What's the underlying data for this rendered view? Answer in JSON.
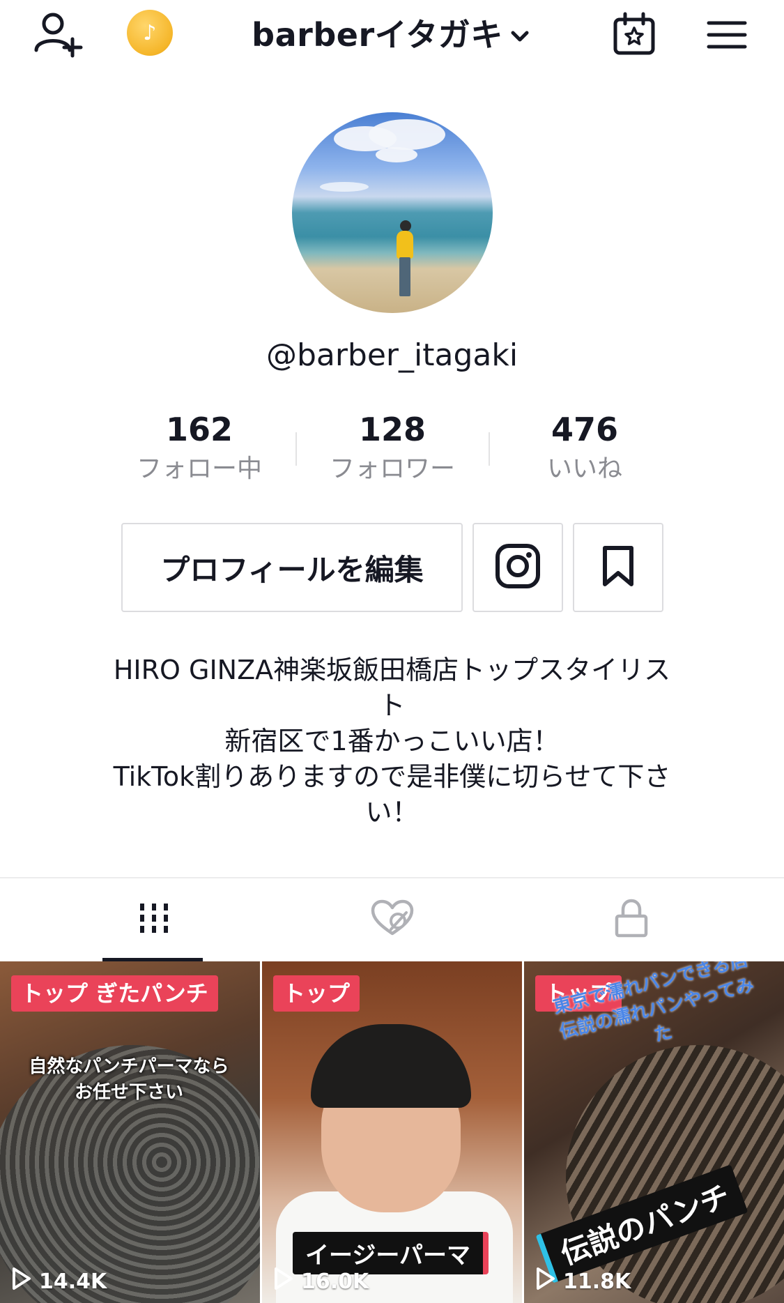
{
  "header": {
    "username_title": "barberイタガキ",
    "icons": [
      "add-user-icon",
      "coin-icon",
      "chevron-down-icon",
      "calendar-star-icon",
      "menu-icon"
    ]
  },
  "profile": {
    "handle": "@barber_itagaki",
    "stats": [
      {
        "value": "162",
        "label": "フォロー中"
      },
      {
        "value": "128",
        "label": "フォロワー"
      },
      {
        "value": "476",
        "label": "いいね"
      }
    ],
    "edit_button_label": "プロフィールを編集",
    "bio_lines": [
      "HIRO GINZA神楽坂飯田橋店トップスタイリス",
      "ト",
      "新宿区で1番かっこいい店！",
      "TikTok割りありますので是非僕に切らせて下さ",
      "い！"
    ]
  },
  "tabs": [
    {
      "name": "videos",
      "icon": "grid-icon",
      "active": true
    },
    {
      "name": "liked",
      "icon": "hidden-heart-icon",
      "active": false
    },
    {
      "name": "private",
      "icon": "lock-icon",
      "active": false
    }
  ],
  "videos": [
    {
      "badge": "トップ ぎたパンチ",
      "caption": "自然なパンチパーマなら\nお任せ下さい",
      "views": "14.4K"
    },
    {
      "badge": "トップ",
      "caption": "イージーパーマ",
      "views": "16.0K"
    },
    {
      "badge": "トップ",
      "caption_top": "東京で濡れパンできる店\n伝説の濡れパンやってみ\nた",
      "caption": "伝説のパンチ",
      "views": "11.8K"
    }
  ],
  "colors": {
    "badge": "#ea4359",
    "text_primary": "#161823",
    "text_secondary": "#8a8b91",
    "border": "#dcdcdf"
  }
}
